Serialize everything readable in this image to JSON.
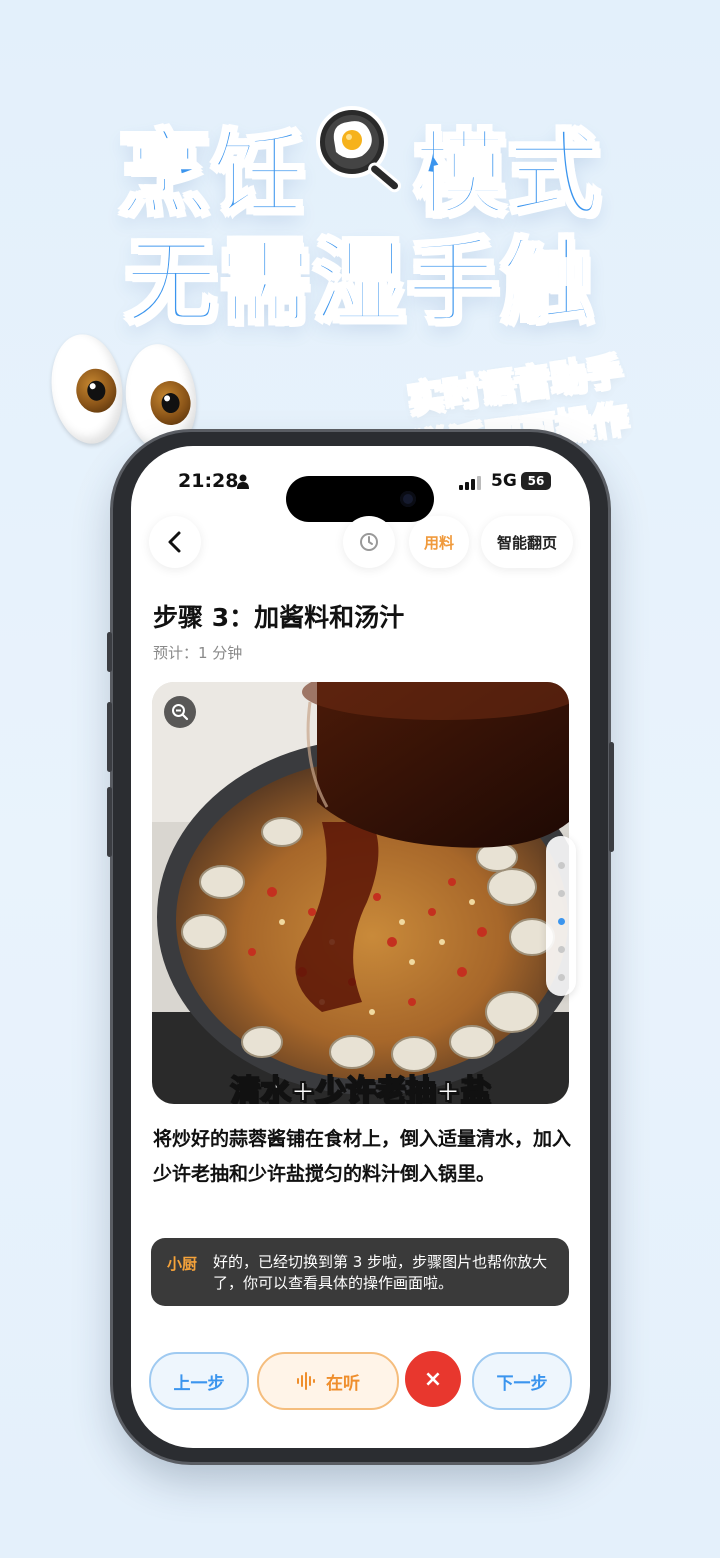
{
  "promo": {
    "headline_line1_a": "烹饪",
    "headline_line1_b": "模式",
    "headline_line2": "无需湿手触",
    "tag_line1": "实时语音助手",
    "tag_line2": "说话即可操作",
    "pan_icon": "frying-pan-egg-icon",
    "eyes_icon": "eyes-emoji-icon"
  },
  "status_bar": {
    "time": "21:28",
    "network": "5G",
    "battery": "56"
  },
  "topbar": {
    "back_icon": "chevron-left-icon",
    "timer_icon": "timer-icon",
    "ingredients_label": "用料",
    "smart_page_label": "智能翻页"
  },
  "step": {
    "title": "步骤 3：加酱料和汤汁",
    "estimate": "预计：1 分钟",
    "image_caption": "清水+少许老抽+盐",
    "description": "将炒好的蒜蓉酱铺在食材上，倒入适量清水，加入少许老抽和少许盐搅匀的料汁倒入锅里。"
  },
  "assistant": {
    "name": "小厨",
    "message": "好的，已经切换到第 3 步啦，步骤图片也帮你放大了，你可以查看具体的操作画面啦。"
  },
  "controls": {
    "prev_label": "上一步",
    "listening_label": "在听",
    "close_label": "×",
    "next_label": "下一步"
  },
  "colors": {
    "brand_blue": "#3b95ee",
    "accent_orange": "#f09a3c",
    "close_red": "#e8372e"
  }
}
